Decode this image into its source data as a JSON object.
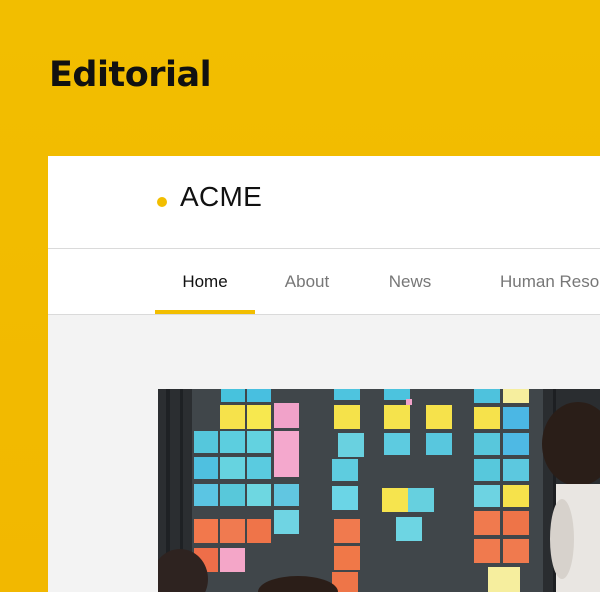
{
  "card": {
    "title": "Editorial"
  },
  "site": {
    "brand": "ACME"
  },
  "nav": {
    "tabs": [
      {
        "label": "Home",
        "active": true
      },
      {
        "label": "About",
        "active": false
      },
      {
        "label": "News",
        "active": false
      },
      {
        "label": "Human Reso",
        "active": false
      }
    ]
  },
  "colors": {
    "accent": "#F2BE00",
    "background": "#F3F3F3",
    "text": "#111111",
    "muted": "#777777"
  }
}
